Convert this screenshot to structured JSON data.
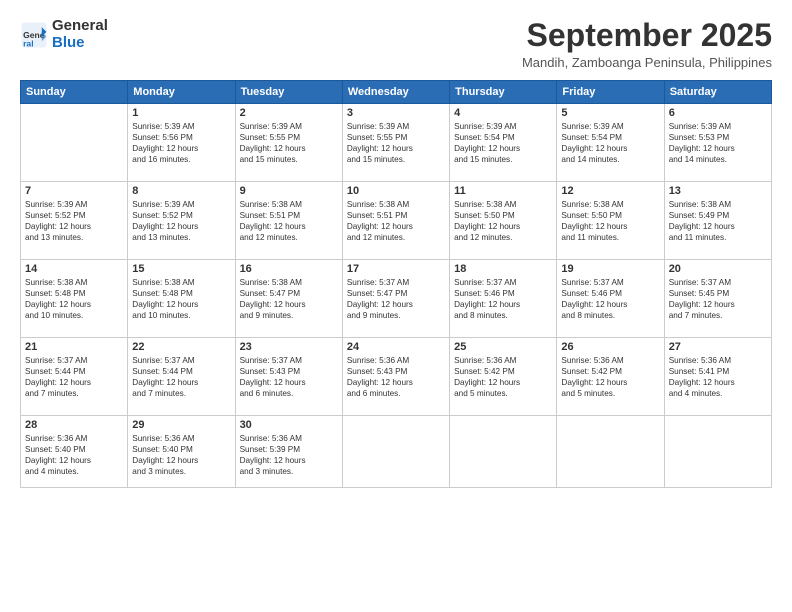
{
  "header": {
    "logo_line1": "General",
    "logo_line2": "Blue",
    "month": "September 2025",
    "location": "Mandih, Zamboanga Peninsula, Philippines"
  },
  "weekdays": [
    "Sunday",
    "Monday",
    "Tuesday",
    "Wednesday",
    "Thursday",
    "Friday",
    "Saturday"
  ],
  "weeks": [
    [
      {
        "day": "",
        "info": ""
      },
      {
        "day": "1",
        "info": "Sunrise: 5:39 AM\nSunset: 5:56 PM\nDaylight: 12 hours\nand 16 minutes."
      },
      {
        "day": "2",
        "info": "Sunrise: 5:39 AM\nSunset: 5:55 PM\nDaylight: 12 hours\nand 15 minutes."
      },
      {
        "day": "3",
        "info": "Sunrise: 5:39 AM\nSunset: 5:55 PM\nDaylight: 12 hours\nand 15 minutes."
      },
      {
        "day": "4",
        "info": "Sunrise: 5:39 AM\nSunset: 5:54 PM\nDaylight: 12 hours\nand 15 minutes."
      },
      {
        "day": "5",
        "info": "Sunrise: 5:39 AM\nSunset: 5:54 PM\nDaylight: 12 hours\nand 14 minutes."
      },
      {
        "day": "6",
        "info": "Sunrise: 5:39 AM\nSunset: 5:53 PM\nDaylight: 12 hours\nand 14 minutes."
      }
    ],
    [
      {
        "day": "7",
        "info": "Sunrise: 5:39 AM\nSunset: 5:52 PM\nDaylight: 12 hours\nand 13 minutes."
      },
      {
        "day": "8",
        "info": "Sunrise: 5:39 AM\nSunset: 5:52 PM\nDaylight: 12 hours\nand 13 minutes."
      },
      {
        "day": "9",
        "info": "Sunrise: 5:38 AM\nSunset: 5:51 PM\nDaylight: 12 hours\nand 12 minutes."
      },
      {
        "day": "10",
        "info": "Sunrise: 5:38 AM\nSunset: 5:51 PM\nDaylight: 12 hours\nand 12 minutes."
      },
      {
        "day": "11",
        "info": "Sunrise: 5:38 AM\nSunset: 5:50 PM\nDaylight: 12 hours\nand 12 minutes."
      },
      {
        "day": "12",
        "info": "Sunrise: 5:38 AM\nSunset: 5:50 PM\nDaylight: 12 hours\nand 11 minutes."
      },
      {
        "day": "13",
        "info": "Sunrise: 5:38 AM\nSunset: 5:49 PM\nDaylight: 12 hours\nand 11 minutes."
      }
    ],
    [
      {
        "day": "14",
        "info": "Sunrise: 5:38 AM\nSunset: 5:48 PM\nDaylight: 12 hours\nand 10 minutes."
      },
      {
        "day": "15",
        "info": "Sunrise: 5:38 AM\nSunset: 5:48 PM\nDaylight: 12 hours\nand 10 minutes."
      },
      {
        "day": "16",
        "info": "Sunrise: 5:38 AM\nSunset: 5:47 PM\nDaylight: 12 hours\nand 9 minutes."
      },
      {
        "day": "17",
        "info": "Sunrise: 5:37 AM\nSunset: 5:47 PM\nDaylight: 12 hours\nand 9 minutes."
      },
      {
        "day": "18",
        "info": "Sunrise: 5:37 AM\nSunset: 5:46 PM\nDaylight: 12 hours\nand 8 minutes."
      },
      {
        "day": "19",
        "info": "Sunrise: 5:37 AM\nSunset: 5:46 PM\nDaylight: 12 hours\nand 8 minutes."
      },
      {
        "day": "20",
        "info": "Sunrise: 5:37 AM\nSunset: 5:45 PM\nDaylight: 12 hours\nand 7 minutes."
      }
    ],
    [
      {
        "day": "21",
        "info": "Sunrise: 5:37 AM\nSunset: 5:44 PM\nDaylight: 12 hours\nand 7 minutes."
      },
      {
        "day": "22",
        "info": "Sunrise: 5:37 AM\nSunset: 5:44 PM\nDaylight: 12 hours\nand 7 minutes."
      },
      {
        "day": "23",
        "info": "Sunrise: 5:37 AM\nSunset: 5:43 PM\nDaylight: 12 hours\nand 6 minutes."
      },
      {
        "day": "24",
        "info": "Sunrise: 5:36 AM\nSunset: 5:43 PM\nDaylight: 12 hours\nand 6 minutes."
      },
      {
        "day": "25",
        "info": "Sunrise: 5:36 AM\nSunset: 5:42 PM\nDaylight: 12 hours\nand 5 minutes."
      },
      {
        "day": "26",
        "info": "Sunrise: 5:36 AM\nSunset: 5:42 PM\nDaylight: 12 hours\nand 5 minutes."
      },
      {
        "day": "27",
        "info": "Sunrise: 5:36 AM\nSunset: 5:41 PM\nDaylight: 12 hours\nand 4 minutes."
      }
    ],
    [
      {
        "day": "28",
        "info": "Sunrise: 5:36 AM\nSunset: 5:40 PM\nDaylight: 12 hours\nand 4 minutes."
      },
      {
        "day": "29",
        "info": "Sunrise: 5:36 AM\nSunset: 5:40 PM\nDaylight: 12 hours\nand 3 minutes."
      },
      {
        "day": "30",
        "info": "Sunrise: 5:36 AM\nSunset: 5:39 PM\nDaylight: 12 hours\nand 3 minutes."
      },
      {
        "day": "",
        "info": ""
      },
      {
        "day": "",
        "info": ""
      },
      {
        "day": "",
        "info": ""
      },
      {
        "day": "",
        "info": ""
      }
    ]
  ]
}
